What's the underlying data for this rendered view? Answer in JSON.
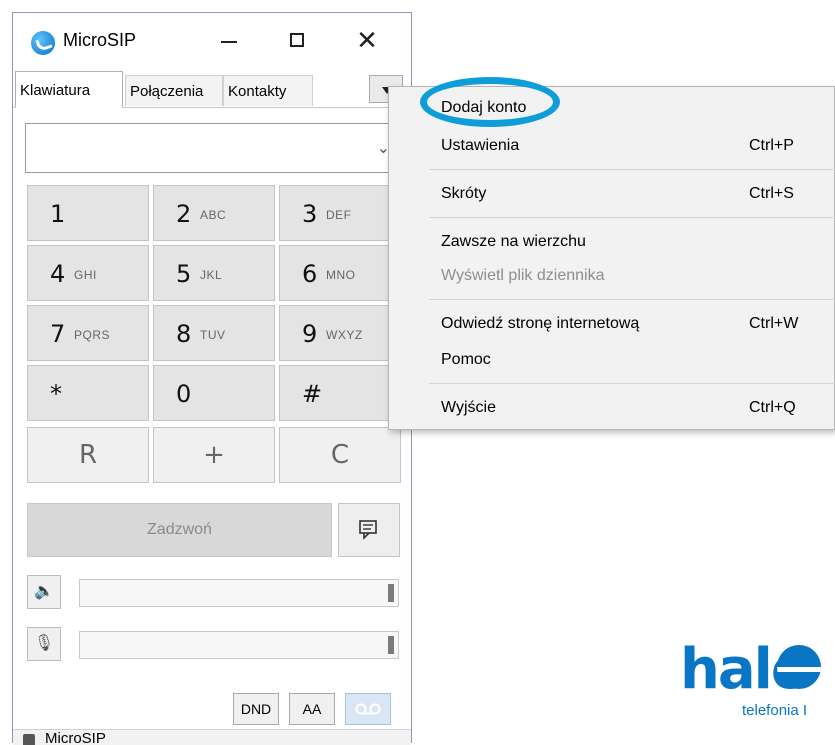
{
  "window": {
    "title": "MicroSIP",
    "icon": "microsip-phone-icon"
  },
  "tabs": [
    {
      "label": "Klawiatura"
    },
    {
      "label": "Połączenia"
    },
    {
      "label": "Kontakty"
    }
  ],
  "dial_input": {
    "value": "",
    "placeholder": ""
  },
  "keypad": [
    {
      "digit": "1",
      "letters": ""
    },
    {
      "digit": "2",
      "letters": "ABC"
    },
    {
      "digit": "3",
      "letters": "DEF"
    },
    {
      "digit": "4",
      "letters": "GHI"
    },
    {
      "digit": "5",
      "letters": "JKL"
    },
    {
      "digit": "6",
      "letters": "MNO"
    },
    {
      "digit": "7",
      "letters": "PQRS"
    },
    {
      "digit": "8",
      "letters": "TUV"
    },
    {
      "digit": "9",
      "letters": "WXYZ"
    },
    {
      "digit": "*",
      "letters": ""
    },
    {
      "digit": "0",
      "letters": ""
    },
    {
      "digit": "#",
      "letters": ""
    }
  ],
  "function_keys": {
    "redial": "R",
    "plus": "+",
    "clear": "C"
  },
  "call_button": {
    "label": "Zadzwoń"
  },
  "controls": {
    "dnd": "DND",
    "aa": "AA",
    "voicemail_icon": "voicemail-icon"
  },
  "status_bar": {
    "text": "MicroSIP"
  },
  "menu": {
    "items": [
      {
        "label": "Dodaj konto",
        "shortcut": ""
      },
      {
        "label": "Ustawienia",
        "shortcut": "Ctrl+P"
      },
      {
        "label": "Skróty",
        "shortcut": "Ctrl+S"
      },
      {
        "label": "Zawsze na wierzchu",
        "shortcut": ""
      },
      {
        "label": "Wyświetl plik dziennika",
        "shortcut": "",
        "disabled": true
      },
      {
        "label": "Odwiedź stronę internetową",
        "shortcut": "Ctrl+W"
      },
      {
        "label": "Pomoc",
        "shortcut": ""
      },
      {
        "label": "Wyjście",
        "shortcut": "Ctrl+Q"
      }
    ],
    "highlight_color": "#0d9ed9"
  },
  "logo": {
    "wordmark": "halo",
    "tagline": "telefonia I",
    "color": "#0876c4"
  }
}
